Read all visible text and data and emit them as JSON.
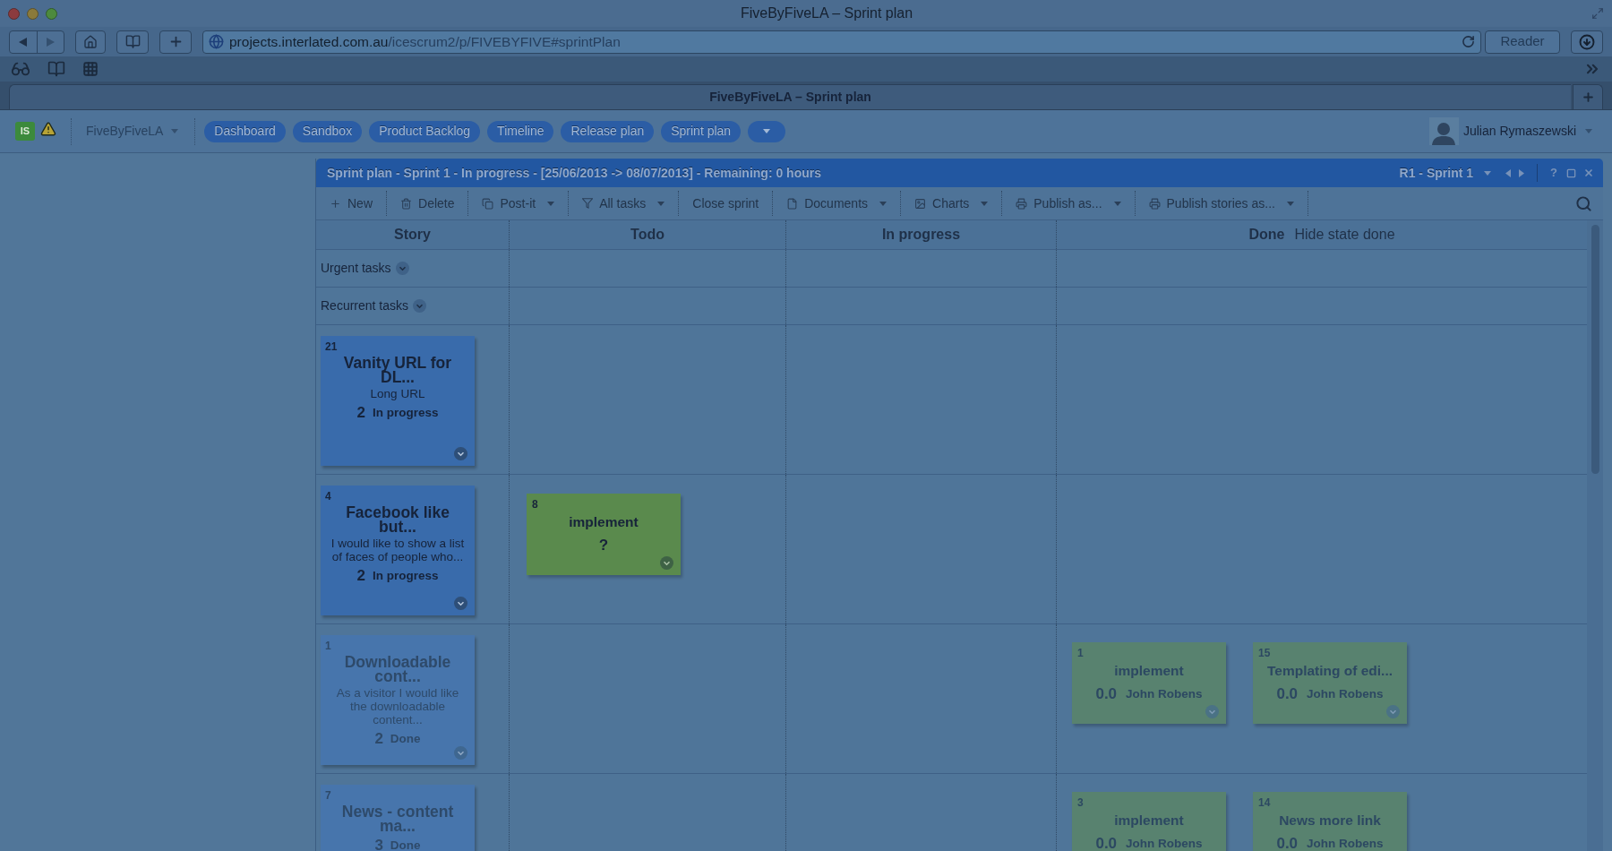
{
  "browser": {
    "title": "FiveByFiveLA – Sprint plan",
    "address": {
      "host": "projects.interlated.com.au",
      "path": "/icescrum2/p/FIVEBYFIVE#sprintPlan"
    },
    "reader": {
      "label": "Reader",
      "disabled": true
    },
    "tab": "FiveByFiveLA – Sprint plan"
  },
  "app_nav": {
    "logo": "IS",
    "project": "FiveByFiveLA",
    "items": [
      "Dashboard",
      "Sandbox",
      "Product Backlog",
      "Timeline",
      "Release plan",
      "Sprint plan"
    ],
    "user": "Julian Rymaszewski"
  },
  "panel": {
    "title": "Sprint plan - Sprint 1 - In progress - [25/06/2013 -> 08/07/2013] - Remaining: 0 hours",
    "sprint": "R1 - Sprint 1",
    "help": "?"
  },
  "toolbar": [
    {
      "label": "New",
      "kind": "plus",
      "dropdown": false
    },
    {
      "label": "Delete",
      "kind": "trash",
      "dropdown": false
    },
    {
      "label": "Post-it",
      "kind": "postit",
      "dropdown": true
    },
    {
      "label": "All tasks",
      "kind": "filter",
      "dropdown": true
    },
    {
      "label": "Close sprint",
      "kind": "plain",
      "dropdown": false
    },
    {
      "label": "Documents",
      "kind": "document",
      "dropdown": true
    },
    {
      "label": "Charts",
      "kind": "chart",
      "dropdown": true
    },
    {
      "label": "Publish as...",
      "kind": "printer",
      "dropdown": true
    },
    {
      "label": "Publish stories as...",
      "kind": "printer",
      "dropdown": true
    }
  ],
  "board": {
    "columns": [
      "Story",
      "Todo",
      "In progress",
      "Done"
    ],
    "hide_done": "Hide state done",
    "task_groups": [
      "Urgent tasks",
      "Recurrent tasks"
    ],
    "rows": [
      {
        "story": {
          "number": "21",
          "title": "Vanity URL for DL...",
          "description": "Long URL",
          "points": "2",
          "state": "In progress",
          "done": false
        }
      },
      {
        "story": {
          "number": "4",
          "title": "Facebook like but...",
          "description": "I would like to show a list of faces of people who...",
          "points": "2",
          "state": "In progress",
          "done": false
        },
        "todo": [
          {
            "number": "8",
            "title": "implement",
            "estimate": "?",
            "done": false
          }
        ]
      },
      {
        "story": {
          "number": "1",
          "title": "Downloadable cont...",
          "description": "As a visitor I would like the downloadable content...",
          "points": "2",
          "state": "Done",
          "done": true
        },
        "done": [
          {
            "number": "1",
            "title": "implement",
            "estimate": "0.0",
            "assignee": "John Robens",
            "done": true
          },
          {
            "number": "15",
            "title": "Templating of edi...",
            "estimate": "0.0",
            "assignee": "John Robens",
            "done": true
          }
        ]
      },
      {
        "story": {
          "number": "7",
          "title": "News - content ma...",
          "points": "3",
          "state": "Done",
          "done": true
        },
        "done": [
          {
            "number": "3",
            "title": "implement",
            "estimate": "0.0",
            "assignee": "John Robens",
            "done": true
          },
          {
            "number": "14",
            "title": "News more link",
            "estimate": "0.0",
            "assignee": "John Robens",
            "done": true
          }
        ]
      }
    ]
  }
}
